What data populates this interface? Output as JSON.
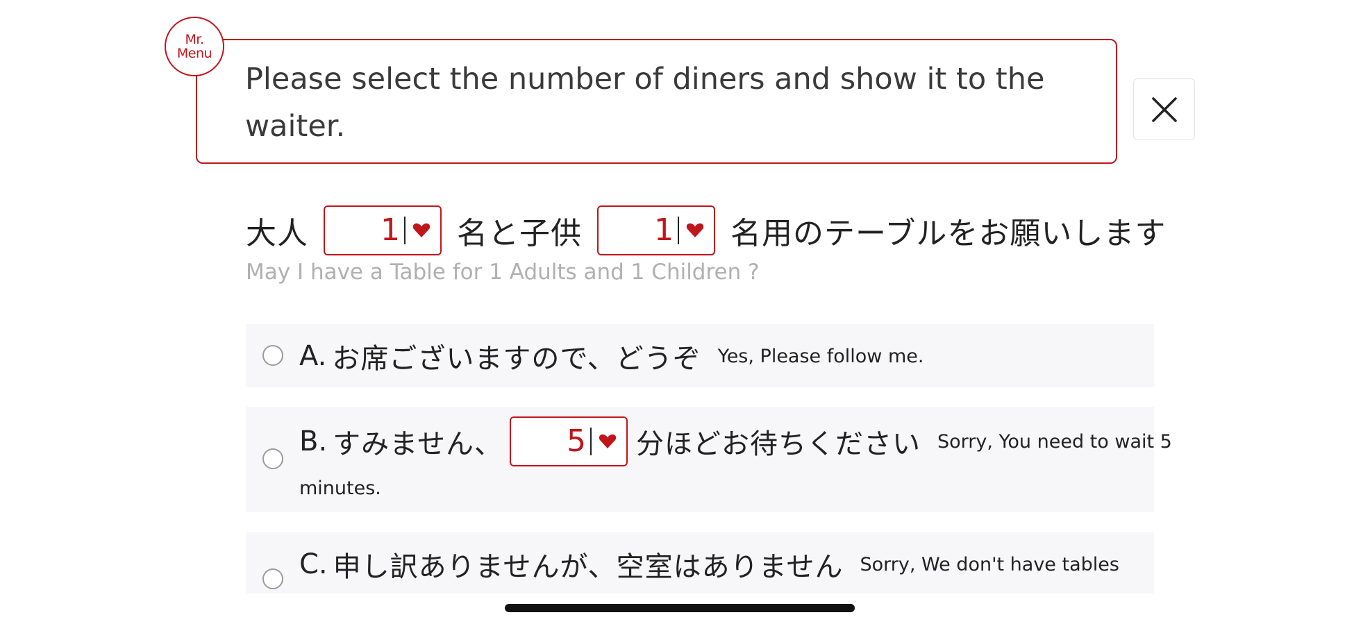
{
  "logo": {
    "line1": "Mr.",
    "line2": "Menu"
  },
  "instruction": {
    "text": "Please select the number of diners and show it to the waiter."
  },
  "close": {
    "icon": "close-icon"
  },
  "request": {
    "adult_prefix": "大人",
    "adult_count": "1",
    "middle_text": "名と子供",
    "child_count": "1",
    "suffix": "名用のテーブルをお願いします",
    "translation": "May I have a Table for 1 Adults and 1 Children ?"
  },
  "options": [
    {
      "letter": "A.",
      "jp": "お席ございますので、どうぞ",
      "en": "Yes, Please follow me.",
      "selected": false
    },
    {
      "letter": "B.",
      "jp_before": "すみません、",
      "minutes": "5",
      "jp_after": "分ほどお待ちください",
      "en_line1": "Sorry, You need to wait 5",
      "en_line2": "minutes.",
      "selected": false
    },
    {
      "letter": "C.",
      "jp": "申し訳ありませんが、空室はありません",
      "en": "Sorry, We don't have tables",
      "selected": false
    }
  ],
  "colors": {
    "accent": "#c0151b",
    "option_bg": "#f7f7f9",
    "muted_text": "#b0b0b0"
  }
}
